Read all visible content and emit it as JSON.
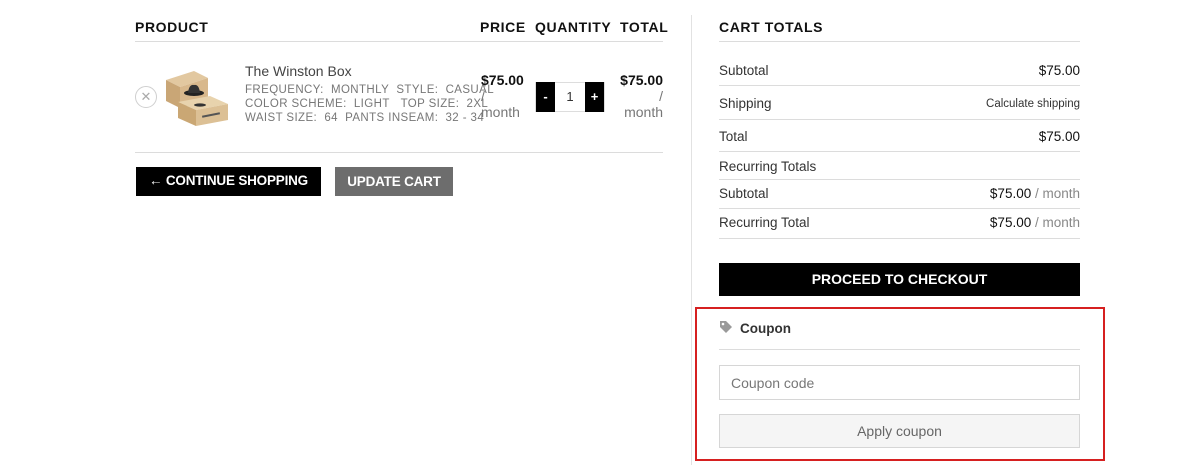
{
  "cart": {
    "headers": {
      "product": "PRODUCT",
      "price": "PRICE",
      "quantity": "QUANTITY",
      "total": "TOTAL"
    },
    "item": {
      "remove_symbol": "✕",
      "name": "The Winston Box",
      "meta": [
        [
          {
            "key": "FREQUENCY:",
            "value": "MONTHLY"
          },
          {
            "key": "STYLE:",
            "value": "CASUAL"
          }
        ],
        [
          {
            "key": "COLOR SCHEME:",
            "value": "LIGHT"
          },
          {
            "key": "TOP SIZE:",
            "value": "2XL"
          }
        ],
        [
          {
            "key": "WAIST SIZE:",
            "value": "64"
          },
          {
            "key": "PANTS INSEAM:",
            "value": "32 - 34"
          }
        ]
      ],
      "price": {
        "amount": "$75.00",
        "suffix_1": "/",
        "suffix_2": "month"
      },
      "quantity": {
        "minus": "-",
        "value": "1",
        "plus": "+"
      },
      "total": {
        "amount": "$75.00",
        "suffix_1": "/",
        "suffix_2": "month"
      }
    },
    "buttons": {
      "continue_label": "← CONTINUE SHOPPING",
      "update_label": "UPDATE CART"
    }
  },
  "totals": {
    "title": "CART TOTALS",
    "subtotal": {
      "label": "Subtotal",
      "value": "$75.00"
    },
    "shipping": {
      "label": "Shipping",
      "value": "Calculate shipping"
    },
    "total": {
      "label": "Total",
      "value": "$75.00"
    },
    "recurring_heading": "Recurring Totals",
    "recurring_subtotal": {
      "label": "Subtotal",
      "value": "$75.00",
      "suffix": " / month"
    },
    "recurring_total": {
      "label": "Recurring Total",
      "value": "$75.00",
      "suffix": " / month"
    },
    "checkout_label": "PROCEED TO CHECKOUT"
  },
  "coupon": {
    "heading": "Coupon",
    "placeholder": "Coupon code",
    "apply_label": "Apply coupon"
  },
  "colors": {
    "highlight": "#d62020",
    "black": "#000000",
    "update_gray": "#6d6d6d"
  }
}
